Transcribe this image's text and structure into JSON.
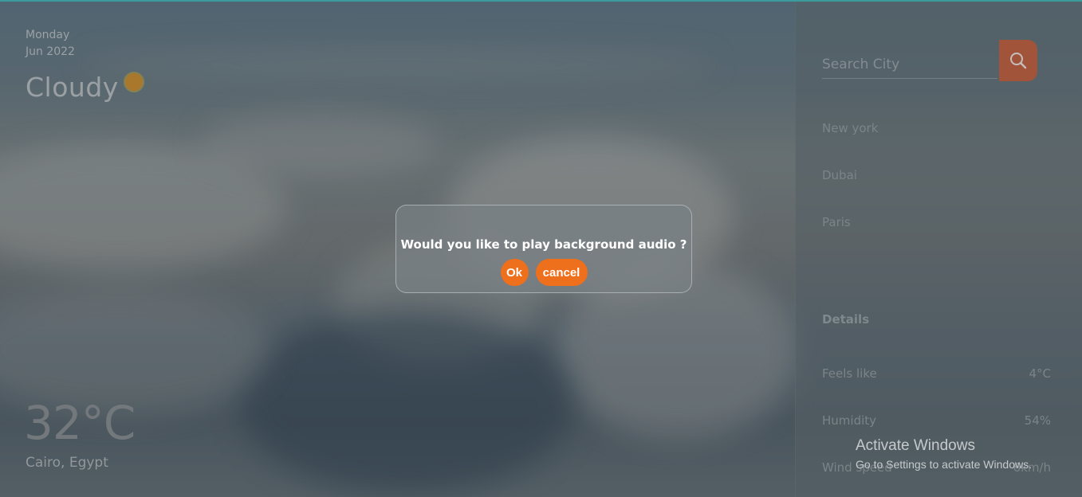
{
  "weather": {
    "day": "Monday",
    "date": "Jun 2022",
    "condition": "Cloudy",
    "condition_icon": "sun-icon",
    "temperature": "32°C",
    "location": "Cairo, Egypt"
  },
  "sidebar": {
    "search_placeholder": "Search City",
    "search_icon": "search-icon",
    "cities": [
      "New york",
      "Dubai",
      "Paris"
    ],
    "details_title": "Details",
    "details": [
      {
        "label": "Feels like",
        "value": "4°C"
      },
      {
        "label": "Humidity",
        "value": "54%"
      },
      {
        "label": "Wind speed",
        "value": "6km/h"
      }
    ]
  },
  "dialog": {
    "message": "Would you like to play background audio ?",
    "ok_label": "Ok",
    "cancel_label": "cancel"
  },
  "watermark": {
    "title": "Activate Windows",
    "subtitle": "Go to Settings to activate Windows."
  },
  "colors": {
    "accent": "#ee6f1c",
    "search_button": "#b0593a"
  }
}
